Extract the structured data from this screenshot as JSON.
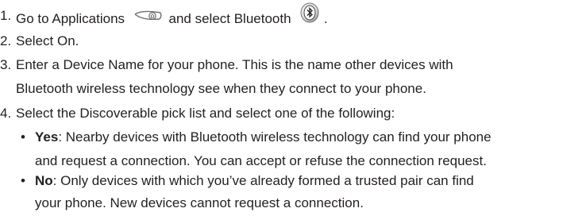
{
  "steps": [
    {
      "num": "1.",
      "prefix": "Go to Applications",
      "icon1": "applications-icon",
      "middle": "and select Bluetooth",
      "icon2": "bluetooth-icon",
      "suffix": "."
    },
    {
      "num": "2.",
      "text": "Select On."
    },
    {
      "num": "3.",
      "lines": [
        "Enter a Device Name for your phone. This is the name other devices with",
        "Bluetooth wireless technology see when they connect to your phone."
      ]
    },
    {
      "num": "4.",
      "text": "Select the Discoverable pick list and select one of the following:"
    }
  ],
  "options": [
    {
      "bullet": "•",
      "label": "Yes",
      "lines": [
        ": Nearby devices with Bluetooth wireless technology can find your phone",
        "and request a connection. You can accept or refuse the connection request."
      ]
    },
    {
      "bullet": "•",
      "label": "No",
      "lines": [
        ": Only devices with which you’ve already formed a trusted pair can find",
        "your phone. New devices cannot request a connection."
      ]
    }
  ]
}
